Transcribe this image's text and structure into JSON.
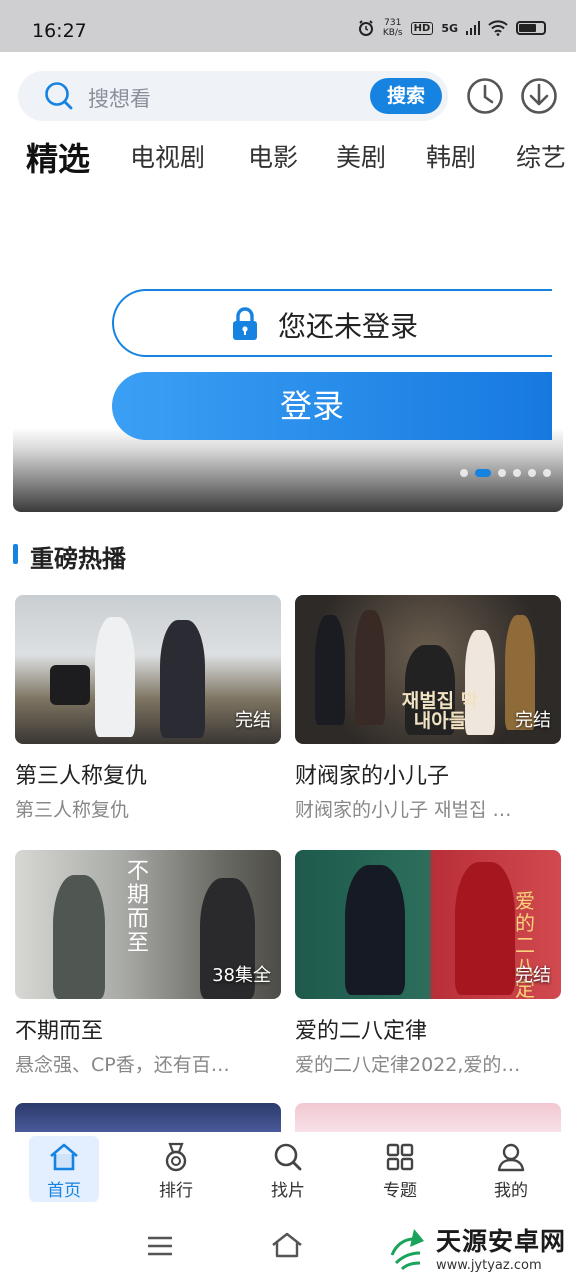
{
  "status_bar": {
    "time": "16:27",
    "speed_value": "731",
    "speed_unit": "KB/s",
    "hd": "HD",
    "network": "5G",
    "battery_level": 0.72
  },
  "header": {
    "search_placeholder": "搜想看",
    "search_button": "搜索",
    "history_icon": "clock-icon",
    "download_icon": "download-icon"
  },
  "tabs": [
    {
      "label": "精选",
      "active": true
    },
    {
      "label": "电视剧",
      "active": false
    },
    {
      "label": "电影",
      "active": false
    },
    {
      "label": "美剧",
      "active": false
    },
    {
      "label": "韩剧",
      "active": false
    },
    {
      "label": "综艺",
      "active": false
    }
  ],
  "banner": {
    "not_logged_in_text": "您还未登录",
    "login_button": "登录",
    "dot_count": 6,
    "active_dot": 1
  },
  "section": {
    "title": "重磅热播"
  },
  "cards": [
    {
      "title": "第三人称复仇",
      "subtitle": "第三人称复仇",
      "badge": "完结"
    },
    {
      "title": "财阀家的小儿子",
      "subtitle": "财阀家的小儿子 재벌집 …",
      "badge": "完结",
      "poster_text": "재벌집 막내아들"
    },
    {
      "title": "不期而至",
      "subtitle": "悬念强、CP香，还有百…",
      "badge": "38集全",
      "poster_text": "不期而至"
    },
    {
      "title": "爱的二八定律",
      "subtitle": "爱的二八定律2022,爱的…",
      "badge": "完结",
      "poster_text": "爱的二八定律"
    }
  ],
  "bottom_nav": [
    {
      "label": "首页",
      "icon": "home-icon",
      "active": true
    },
    {
      "label": "排行",
      "icon": "medal-icon",
      "active": false
    },
    {
      "label": "找片",
      "icon": "search-icon",
      "active": false
    },
    {
      "label": "专题",
      "icon": "grid-icon",
      "active": false
    },
    {
      "label": "我的",
      "icon": "user-icon",
      "active": false
    }
  ],
  "watermark": {
    "name": "天源安卓网",
    "url": "www.jytyaz.com"
  },
  "colors": {
    "accent": "#1683e0",
    "muted": "#888888"
  }
}
